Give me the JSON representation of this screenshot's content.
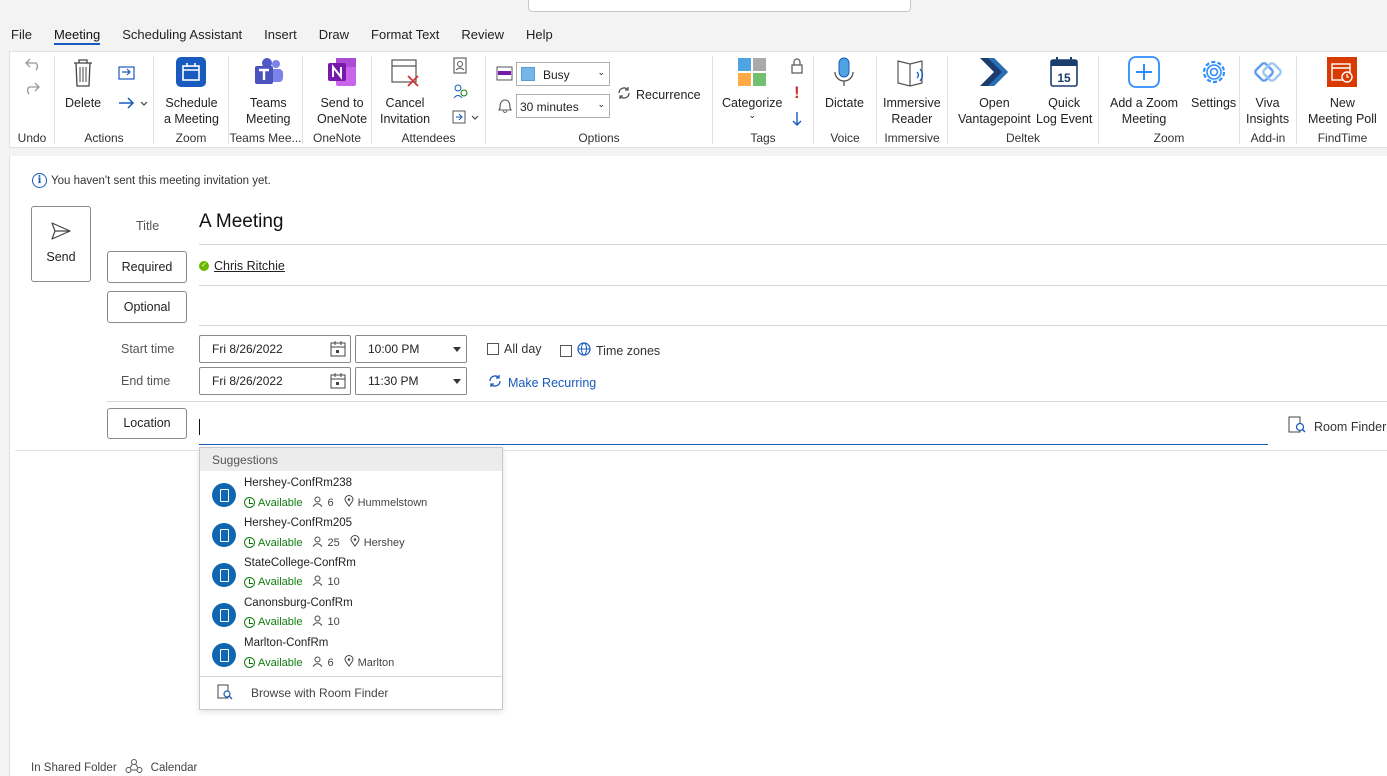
{
  "tabs": [
    "File",
    "Meeting",
    "Scheduling Assistant",
    "Insert",
    "Draw",
    "Format Text",
    "Review",
    "Help"
  ],
  "ribbon": {
    "undo_group": "Undo",
    "actions": {
      "delete": "Delete",
      "group": "Actions"
    },
    "zoom1": {
      "line1": "Schedule",
      "line2": "a Meeting",
      "group": "Zoom"
    },
    "teams": {
      "line1": "Teams",
      "line2": "Meeting",
      "group": "Teams Mee..."
    },
    "onenote": {
      "line1": "Send to",
      "line2": "OneNote",
      "group": "OneNote"
    },
    "attendees": {
      "line1": "Cancel",
      "line2": "Invitation",
      "group": "Attendees"
    },
    "options": {
      "show_as": "Busy",
      "reminder": "30 minutes",
      "recurrence": "Recurrence",
      "group": "Options"
    },
    "tags": {
      "categorize": "Categorize",
      "group": "Tags"
    },
    "voice": {
      "dictate": "Dictate",
      "group": "Voice"
    },
    "immersive": {
      "line1": "Immersive",
      "line2": "Reader",
      "group": "Immersive"
    },
    "deltek": {
      "open_line1": "Open",
      "open_line2": "Vantagepoint",
      "quick_line1": "Quick",
      "quick_line2": "Log Event",
      "group": "Deltek"
    },
    "zoom2": {
      "add_line1": "Add a Zoom",
      "add_line2": "Meeting",
      "settings": "Settings",
      "group": "Zoom"
    },
    "addin": {
      "line1": "Viva",
      "line2": "Insights",
      "group": "Add-in"
    },
    "findtime": {
      "line1": "New",
      "line2": "Meeting Poll",
      "group": "FindTime"
    },
    "colors": {
      "accent": "#185abd",
      "onenote": "#7719aa",
      "teams": "#5059c9",
      "findtime": "#d83b01",
      "deltek": "#1b3d6e"
    }
  },
  "form": {
    "info_message": "You haven't sent this meeting invitation yet.",
    "send_label": "Send",
    "title_label": "Title",
    "title_value": "A Meeting",
    "required_label": "Required",
    "required_attendee": "Chris Ritchie",
    "optional_label": "Optional",
    "start_label": "Start time",
    "start_date": "Fri 8/26/2022",
    "start_time": "10:00 PM",
    "end_label": "End time",
    "end_date": "Fri 8/26/2022",
    "end_time": "11:30 PM",
    "all_day": "All day",
    "time_zones": "Time zones",
    "make_recurring": "Make Recurring",
    "location_label": "Location",
    "location_value": "",
    "room_finder": "Room Finder"
  },
  "suggestions": {
    "header": "Suggestions",
    "rooms": [
      {
        "name": "Hershey-ConfRm238",
        "status": "Available",
        "capacity": "6",
        "place": "Hummelstown"
      },
      {
        "name": "Hershey-ConfRm205",
        "status": "Available",
        "capacity": "25",
        "place": "Hershey"
      },
      {
        "name": "StateCollege-ConfRm",
        "status": "Available",
        "capacity": "10",
        "place": ""
      },
      {
        "name": "Canonsburg-ConfRm",
        "status": "Available",
        "capacity": "10",
        "place": ""
      },
      {
        "name": "Marlton-ConfRm",
        "status": "Available",
        "capacity": "6",
        "place": "Marlton"
      }
    ],
    "browse": "Browse with Room Finder"
  },
  "footer": {
    "folder_text": "In Shared Folder",
    "calendar": "Calendar"
  }
}
